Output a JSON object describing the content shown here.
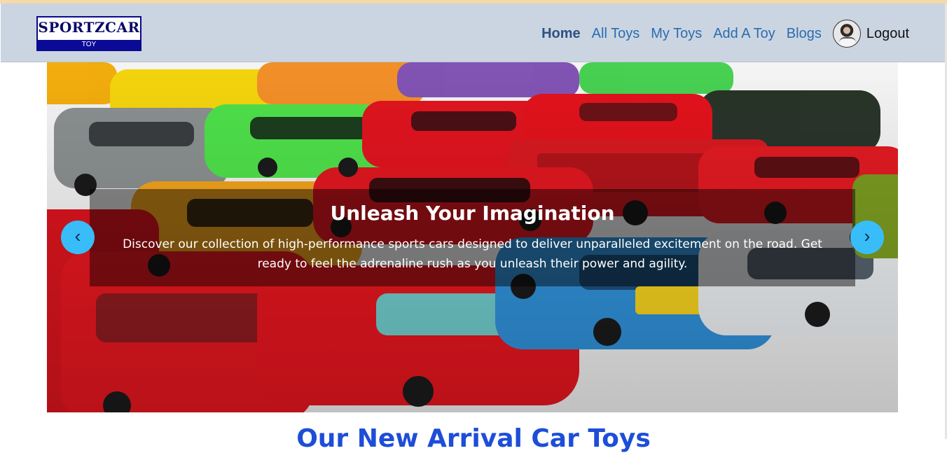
{
  "brand": {
    "name": "SPORTZCAR",
    "tagline": "TOY"
  },
  "nav": {
    "items": [
      {
        "label": "Home",
        "active": true
      },
      {
        "label": "All Toys"
      },
      {
        "label": "My Toys"
      },
      {
        "label": "Add A Toy"
      },
      {
        "label": "Blogs"
      }
    ],
    "logout_label": "Logout"
  },
  "carousel": {
    "title": "Unleash Your Imagination",
    "text": "Discover our collection of high-performance sports cars designed to deliver unparalleled excitement on the road. Get ready to feel the adrenaline rush as you unleash their power and agility.",
    "prev_icon": "chevron-left-icon",
    "next_icon": "chevron-right-icon",
    "prev_glyph": "‹",
    "next_glyph": "›"
  },
  "section": {
    "title": "Our New Arrival Car Toys"
  },
  "colors": {
    "navbar": "#cbd5e1",
    "link": "#2b6cb0",
    "arrow": "#38bdf8",
    "section_title": "#1d4ed8"
  }
}
